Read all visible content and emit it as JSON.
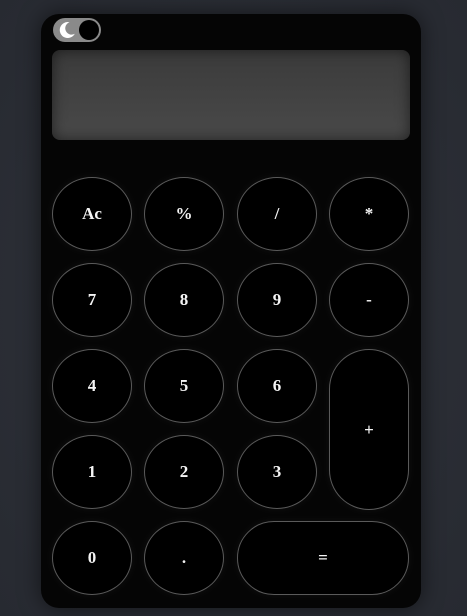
{
  "display": {
    "value": ""
  },
  "theme_toggle": {
    "icon": "crescent-moon-icon"
  },
  "keys": {
    "clear": "Ac",
    "percent": "%",
    "divide": "/",
    "multiply": "*",
    "seven": "7",
    "eight": "8",
    "nine": "9",
    "minus": "-",
    "four": "4",
    "five": "5",
    "six": "6",
    "plus": "+",
    "one": "1",
    "two": "2",
    "three": "3",
    "zero": "0",
    "decimal": ".",
    "equals": "="
  },
  "colors": {
    "background": "#2a2d35",
    "calculator_body": "#050505",
    "display": "#424242",
    "key_border": "#5a5a5a",
    "key_text": "#f4f4f4",
    "toggle_track": "#8a8a8a"
  }
}
